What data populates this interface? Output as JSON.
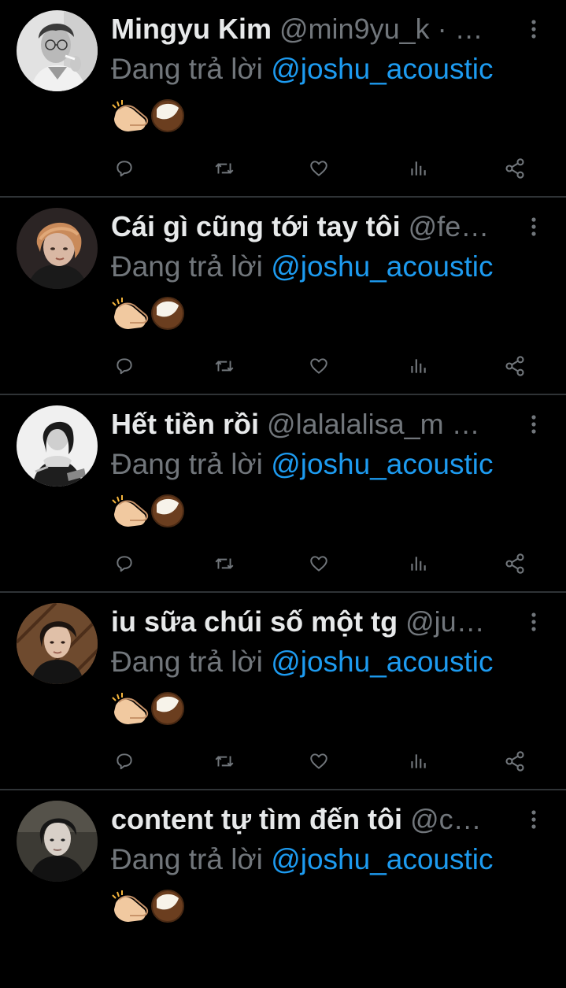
{
  "tweets": [
    {
      "display_name": "Mingyu Kim",
      "handle": "@min9yu_k",
      "separator": " · …",
      "reply_prefix": "Đang trả lời ",
      "reply_to": "@joshu_acoustic",
      "content_emojis": [
        "clapping-hands",
        "coconut"
      ],
      "avatar_icon": "avatar-photo"
    },
    {
      "display_name": "Cái gì cũng tới tay tôi",
      "handle": "@fe…",
      "separator": "",
      "reply_prefix": "Đang trả lời ",
      "reply_to": "@joshu_acoustic",
      "content_emojis": [
        "clapping-hands",
        "coconut"
      ],
      "avatar_icon": "avatar-photo"
    },
    {
      "display_name": "Hết tiền rồi",
      "handle": "@lalalalisa_m",
      "separator": " …",
      "reply_prefix": "Đang trả lời ",
      "reply_to": "@joshu_acoustic",
      "content_emojis": [
        "clapping-hands",
        "coconut"
      ],
      "avatar_icon": "avatar-photo"
    },
    {
      "display_name": "iu sữa chúi số một tg",
      "handle": "@ju…",
      "separator": "",
      "reply_prefix": "Đang trả lời ",
      "reply_to": "@joshu_acoustic",
      "content_emojis": [
        "clapping-hands",
        "coconut"
      ],
      "avatar_icon": "avatar-photo"
    },
    {
      "display_name": "content tự tìm đến tôi",
      "handle": "@c…",
      "separator": "",
      "reply_prefix": "Đang trả lời ",
      "reply_to": "@joshu_acoustic",
      "content_emojis": [
        "clapping-hands",
        "coconut"
      ],
      "avatar_icon": "avatar-photo"
    }
  ],
  "action_icons": [
    "reply-icon",
    "retweet-icon",
    "like-icon",
    "views-icon",
    "share-icon"
  ],
  "colors": {
    "background": "#000000",
    "primary_text": "#e7e9ea",
    "secondary_text": "#71767b",
    "link": "#1d9bf0",
    "divider": "#2f3336"
  }
}
